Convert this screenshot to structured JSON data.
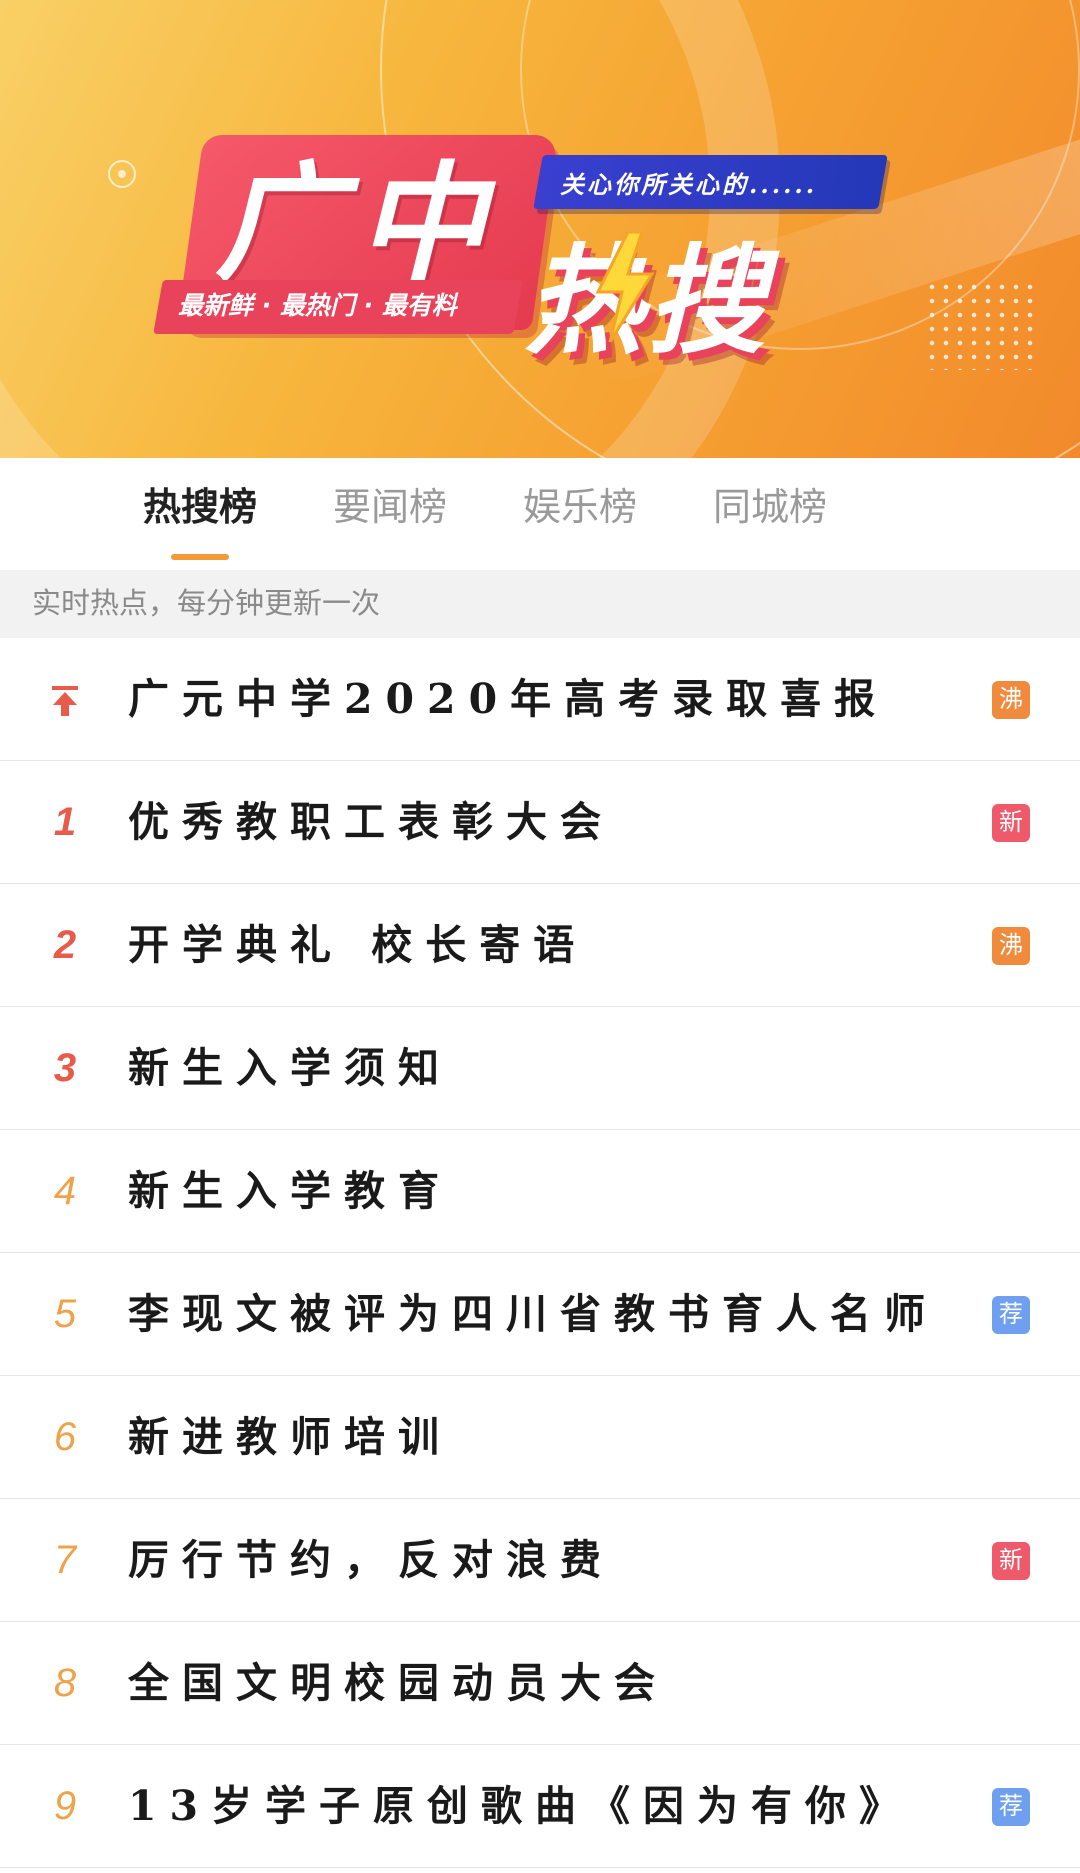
{
  "banner": {
    "logo_title": "广中",
    "tagline": "最新鲜 · 最热门 · 最有料",
    "slogan": "关心你所关心的......",
    "big_word": "热搜"
  },
  "tabs": [
    {
      "label": "热搜榜",
      "active": true
    },
    {
      "label": "要闻榜",
      "active": false
    },
    {
      "label": "娱乐榜",
      "active": false
    },
    {
      "label": "同城榜",
      "active": false
    }
  ],
  "info_text": "实时热点，每分钟更新一次",
  "colors": {
    "accent": "#f29c38",
    "badge_hot": "#f08a3c",
    "badge_new": "#ee5a6a",
    "badge_recommend": "#6fa0f0"
  },
  "items": [
    {
      "rank": "",
      "rank_icon": "pin-top-icon",
      "title": "广元中学2020年高考录取喜报",
      "badge": "沸",
      "badge_type": "hot"
    },
    {
      "rank": "1",
      "title": "优秀教职工表彰大会",
      "badge": "新",
      "badge_type": "new"
    },
    {
      "rank": "2",
      "title": "开学典礼  校长寄语",
      "badge": "沸",
      "badge_type": "hot"
    },
    {
      "rank": "3",
      "title": "新生入学须知",
      "badge": "",
      "badge_type": ""
    },
    {
      "rank": "4",
      "title": "新生入学教育",
      "badge": "",
      "badge_type": ""
    },
    {
      "rank": "5",
      "title": "李现文被评为四川省教书育人名师",
      "badge": "荐",
      "badge_type": "recommend"
    },
    {
      "rank": "6",
      "title": "新进教师培训",
      "badge": "",
      "badge_type": ""
    },
    {
      "rank": "7",
      "title": "厉行节约，反对浪费",
      "badge": "新",
      "badge_type": "new"
    },
    {
      "rank": "8",
      "title": "全国文明校园动员大会",
      "badge": "",
      "badge_type": ""
    },
    {
      "rank": "9",
      "title": "13岁学子原创歌曲《因为有你》",
      "badge": "荐",
      "badge_type": "recommend"
    }
  ]
}
